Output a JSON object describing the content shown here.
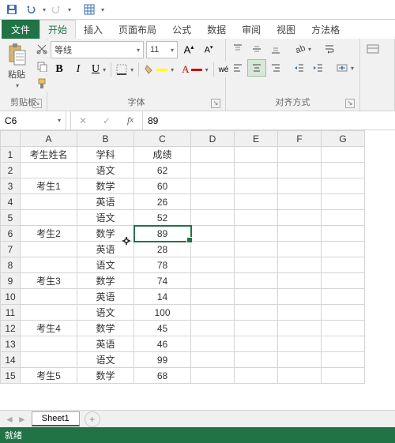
{
  "qat": {
    "save": "save-icon",
    "undo": "undo-icon",
    "redo": "redo-icon",
    "customize": "customize-icon"
  },
  "tabs": {
    "file": "文件",
    "items": [
      "开始",
      "插入",
      "页面布局",
      "公式",
      "数据",
      "审阅",
      "视图",
      "方法格"
    ],
    "active_index": 0
  },
  "ribbon": {
    "clipboard": {
      "label": "剪贴板",
      "paste": "粘贴"
    },
    "font": {
      "label": "字体",
      "name": "等线",
      "size": "11",
      "increase": "A",
      "decrease": "A",
      "bold": "B",
      "italic": "I",
      "underline": "U",
      "wen": "wén"
    },
    "align": {
      "label": "对齐方式"
    }
  },
  "formula_bar": {
    "cell_ref": "C6",
    "value": "89"
  },
  "columns": [
    "A",
    "B",
    "C",
    "D",
    "E",
    "F",
    "G"
  ],
  "chart_data": {
    "type": "table",
    "headers": [
      "考生姓名",
      "学科",
      "成绩"
    ],
    "rows": [
      [
        "",
        "语文",
        62
      ],
      [
        "考生1",
        "数学",
        60
      ],
      [
        "",
        "英语",
        26
      ],
      [
        "",
        "语文",
        52
      ],
      [
        "考生2",
        "数学",
        89
      ],
      [
        "",
        "英语",
        28
      ],
      [
        "",
        "语文",
        78
      ],
      [
        "考生3",
        "数学",
        74
      ],
      [
        "",
        "英语",
        14
      ],
      [
        "",
        "语文",
        100
      ],
      [
        "考生4",
        "数学",
        45
      ],
      [
        "",
        "英语",
        46
      ],
      [
        "",
        "语文",
        99
      ],
      [
        "考生5",
        "数学",
        68
      ]
    ]
  },
  "selected_cell": {
    "row": 6,
    "col": "C"
  },
  "sheet": {
    "name": "Sheet1"
  },
  "status": "就绪"
}
